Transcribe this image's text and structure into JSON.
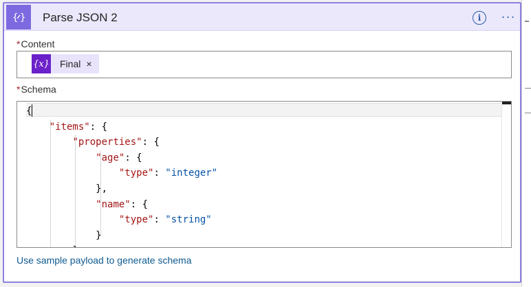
{
  "action": {
    "title": "Parse JSON 2",
    "header_icon": "json-braces-icon",
    "info_symbol": "i",
    "more_symbol": "···"
  },
  "content": {
    "required_mark": "*",
    "label": "Content",
    "token": {
      "icon_text": "{x}",
      "label": "Final",
      "remove_symbol": "×"
    }
  },
  "schema": {
    "required_mark": "*",
    "label": "Schema",
    "code_lines": [
      [
        {
          "t": "p",
          "v": "{"
        }
      ],
      [
        {
          "t": "p",
          "v": "    "
        },
        {
          "t": "k",
          "v": "\"items\""
        },
        {
          "t": "p",
          "v": ": {"
        }
      ],
      [
        {
          "t": "p",
          "v": "        "
        },
        {
          "t": "k",
          "v": "\"properties\""
        },
        {
          "t": "p",
          "v": ": {"
        }
      ],
      [
        {
          "t": "p",
          "v": "            "
        },
        {
          "t": "k",
          "v": "\"age\""
        },
        {
          "t": "p",
          "v": ": {"
        }
      ],
      [
        {
          "t": "p",
          "v": "                "
        },
        {
          "t": "k",
          "v": "\"type\""
        },
        {
          "t": "p",
          "v": ": "
        },
        {
          "t": "s",
          "v": "\"integer\""
        }
      ],
      [
        {
          "t": "p",
          "v": "            },"
        }
      ],
      [
        {
          "t": "p",
          "v": "            "
        },
        {
          "t": "k",
          "v": "\"name\""
        },
        {
          "t": "p",
          "v": ": {"
        }
      ],
      [
        {
          "t": "p",
          "v": "                "
        },
        {
          "t": "k",
          "v": "\"type\""
        },
        {
          "t": "p",
          "v": ": "
        },
        {
          "t": "s",
          "v": "\"string\""
        }
      ],
      [
        {
          "t": "p",
          "v": "            }"
        }
      ],
      [
        {
          "t": "p",
          "v": "        }"
        }
      ]
    ]
  },
  "footer": {
    "link_label": "Use sample payload to generate schema"
  },
  "colors": {
    "accent": "#7e6ae0",
    "card_border": "#8c80df",
    "token_icon": "#6b21c9",
    "key": "#a31515",
    "string": "#0451a5",
    "link": "#0f5a8f"
  }
}
